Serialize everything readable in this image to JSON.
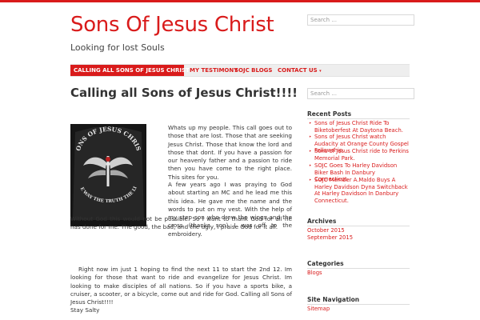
{
  "site": {
    "title": "Sons Of Jesus Christ",
    "tagline": "Looking for lost Souls",
    "search_placeholder": "Search ..."
  },
  "nav": [
    {
      "label": "CALLING ALL SONS OF JESUS CHRIST!!!!",
      "active": true
    },
    {
      "label": "MY TESTIMONY",
      "active": false
    },
    {
      "label": "SOJC BLOGS",
      "active": false
    },
    {
      "label": "CONTACT US",
      "active": false
    }
  ],
  "post": {
    "title": "Calling all Sons of Jesus Christ!!!!",
    "p1": "Whats up my people. This call goes out to those that are lost. Those that are seeking Jesus Christ. Those that know the lord and those that dont. If you have a passion for our heavenly father and a passion to ride then you have come to the right place. This sites for you.",
    "p2a": "A few years ago I was praying to God about starting an MC and he lead me this this idea. He gave me the name and the words to put on my vest. With the help of my step son who drew the wings and the cross (thanks son) I was off to the embroidery.",
    "p2b": "Without God this would not be possible. So I want to thank God for all he has done for me. The good, the bad, and the ugly, I praise God for it all.",
    "p3": "Right now im just 1 hoping to find the next 11 to start the 2nd 12. Im looking for those that want to ride and evangelize for Jesus Christ. Im looking to make disciples of all nations. So if you have a sports bike, a cruiser, a scooter, or a bicycle, come out and ride for God. Calling all Sons of Jesus Christ!!!!",
    "signoff": "Stay Salty",
    "image_text_top": "SONS OF JESUS CHRIST",
    "image_text_bottom": "THE WAY THE TRUTH THE LIFE"
  },
  "sidebar": {
    "search_placeholder": "Search ...",
    "recent_title": "Recent Posts",
    "recent": [
      "Sons of Jesus Christ Ride To Biketoberfest At Daytona Beach.",
      "Sons of Jesus Christ watch Audacity at Orange County Gospel Fellowship.",
      "Sons of Jesus Christ ride to Perkins Memorial Park.",
      "SOJC Goes To Harley Davidson Biker Bash In Danbury Connecticut.",
      "SOJC Member A.Maldo Buys A Harley Davidson Dyna Switchback At Harley Davidson In Danbury Connecticut."
    ],
    "archives_title": "Archives",
    "archives": [
      "October 2015",
      "September 2015"
    ],
    "categories_title": "Categories",
    "categories": [
      "Blogs"
    ],
    "sitenav_title": "Site Navigation",
    "sitenav": [
      "Sitemap"
    ]
  },
  "colors": {
    "accent": "#d91b1b",
    "text": "#333333",
    "nav_bg": "#eeeeee"
  }
}
